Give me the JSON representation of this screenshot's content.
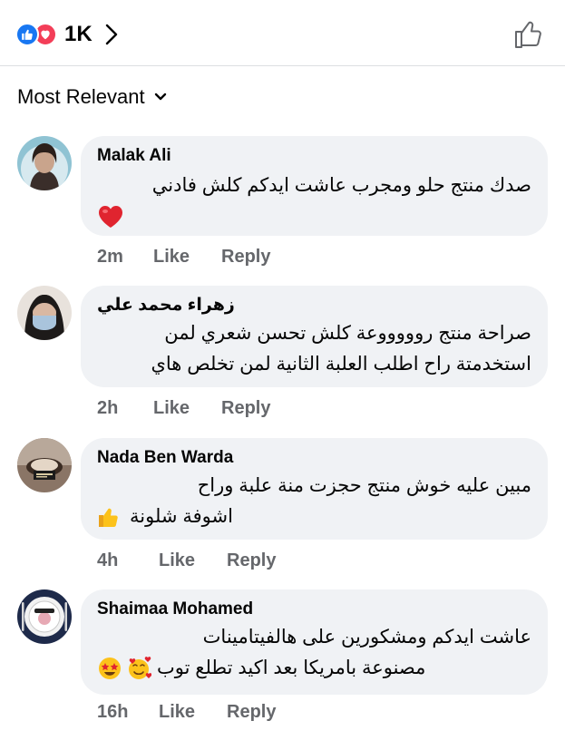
{
  "header": {
    "reaction_count": "1K",
    "colors": {
      "like_blue": "#1877f2",
      "love_red": "#f33e58"
    }
  },
  "sort": {
    "label": "Most Relevant"
  },
  "comments": [
    {
      "author": "Malak Ali",
      "lines": [
        "صدك منتج حلو ومجرب عاشت ايدكم كلش فادني"
      ],
      "emoji": "heart",
      "time": "2m",
      "like_label": "Like",
      "reply_label": "Reply"
    },
    {
      "author": "زهراء محمد علي",
      "lines": [
        "صراحة منتج روووووعة كلش تحسن شعري لمن",
        "استخدمتة راح اطلب العلبة الثانية لمن تخلص هاي"
      ],
      "time": "2h",
      "like_label": "Like",
      "reply_label": "Reply"
    },
    {
      "author": "Nada Ben Warda",
      "lines": [
        "مبين عليه خوش منتج حجزت منة علبة وراح",
        "اشوفة شلونة"
      ],
      "emoji": "thumbs-up",
      "time": "4h",
      "like_label": "Like",
      "reply_label": "Reply"
    },
    {
      "author": "Shaimaa Mohamed",
      "lines": [
        "عاشت ايدكم ومشكورين على هالفيتامينات",
        "مصنوعة بامريكا بعد اكيد تطلع توب"
      ],
      "emoji": "star-struck, smiling-face-with-hearts",
      "time": "16h",
      "like_label": "Like",
      "reply_label": "Reply"
    }
  ]
}
